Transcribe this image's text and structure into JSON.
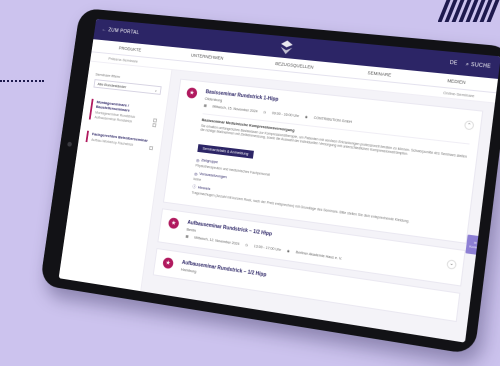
{
  "topbar": {
    "portal_label": "ZUM PORTAL",
    "lang": "DE",
    "search_label": "SUCHE"
  },
  "nav": {
    "items": [
      "PRODUKTE",
      "UNTERNEHMEN",
      "BEZUGSQUELLEN",
      "SEMINARE",
      "MEDIEN"
    ]
  },
  "subnav": {
    "left": "Präsenz-Seminare",
    "right": "Online-Seminare"
  },
  "sidebar": {
    "filter_label": "Seminare filtern",
    "select_value": "Alle Bundesländer",
    "groups": [
      {
        "head": "Montageseminare / Baustellenseminare",
        "items": [
          "Montageseminar Rundstrick",
          "Aufbauseminar Rundstrick"
        ]
      },
      {
        "head": "Fachgerechtes Betreiberseminar",
        "items": [
          "Aufbau-Workshop Flachstrick"
        ]
      }
    ]
  },
  "cards": [
    {
      "pin": "★",
      "title": "Basisseminar Rundstrick 1-Hipp",
      "city": "Oldenburg",
      "date": "Mittwoch, 15. November 2024",
      "time": "09:00 - 16:00 Uhr",
      "org": "CONTRIBUTION GmbH",
      "detail": {
        "heading": "Basisseminar Medizinische Kompressionsversorgung",
        "text": "Sie erhalten umfangreiches Basiswissen zur Kompressionstherapie, um Patienten mit venösen Erkrankungen professionell beraten zu können. Schwerpunkte des Seminars stellen die richtige Maßnehmen mit Zielbeinmessung, sowie die Auswahl der individuellen Versorgung mit unterschiedlichen Kompressionsstrümpfen.",
        "button_label": "Seminardetails & Anmeldung",
        "info": [
          {
            "label": "Zielgruppe",
            "value": "Physiotherapeuten und medizinisches Fachpersonal"
          },
          {
            "label": "Voraussetzungen",
            "value": "keine"
          },
          {
            "label": "Hinweis",
            "value": "Tragemachugen (Anzahl mit kurzem Rock, nach der Preis entsprechen) mit Grundlage des Seminars. Bitte stellen Sie dich entsprechende Kleidung."
          }
        ]
      }
    },
    {
      "pin": "★",
      "title": "Aufbauseminar Rundstrick – 1/2 Hipp",
      "city": "Berlin",
      "date": "Mittwoch, 12. November 2024",
      "time": "13:00 - 17:00 Uhr",
      "org": "Berliner Akademie Haus e. V."
    },
    {
      "pin": "★",
      "title": "Aufbauseminar Rundstrick – 1/2 Hipp",
      "city": "Hamburg"
    }
  ],
  "contact_tab": "Kontakt"
}
